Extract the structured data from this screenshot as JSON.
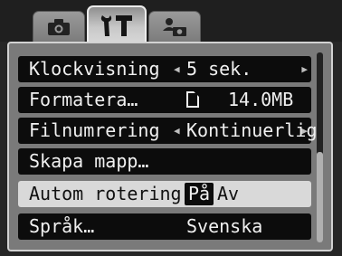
{
  "tabs": [
    {
      "icon": "camera-icon",
      "active": false
    },
    {
      "icon": "wrench-hammer-icon",
      "active": true
    },
    {
      "icon": "person-camera-icon",
      "active": false
    }
  ],
  "menu": {
    "rows": [
      {
        "label": "Klockvisning",
        "value": "5 sek.",
        "arrows": true
      },
      {
        "label": "Formatera…",
        "value": "14.0MB",
        "icon": "memory-card-icon"
      },
      {
        "label": "Filnumrering",
        "value": "Kontinuerlig",
        "arrows": true
      },
      {
        "label": "Skapa mapp…",
        "value": ""
      },
      {
        "label": "Autom rotering",
        "option_on": "På",
        "option_off": "Av",
        "selected": true
      },
      {
        "label": "Språk…",
        "value": "Svenska"
      }
    ]
  },
  "colors": {
    "selected_row": "#d9d9d9",
    "row_bg": "#0c0c0c",
    "panel_bg": "#7a7a7a"
  }
}
